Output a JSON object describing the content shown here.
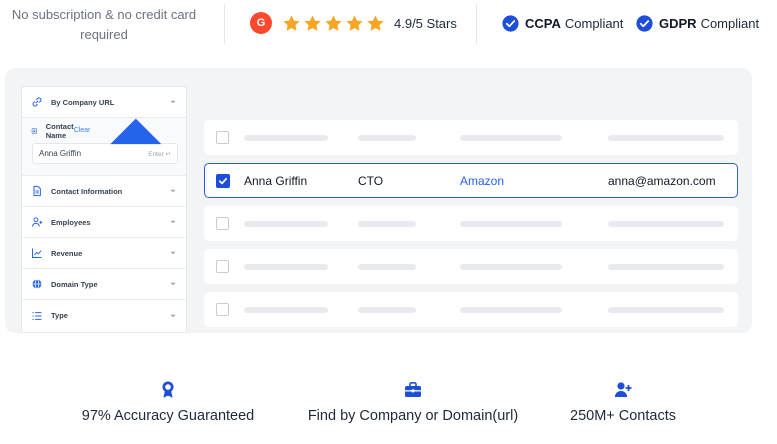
{
  "top_bar": {
    "no_cc_line1": "No subscription & no credit card",
    "no_cc_line2": "required",
    "g2_logo": "G",
    "rating_text": "4.9/5 Stars",
    "star_count": 5,
    "star_color": "#f5a623",
    "badges": [
      {
        "bold": "CCPA",
        "label": "Compliant"
      },
      {
        "bold": "GDPR",
        "label": "Compliant"
      }
    ],
    "badge_color": "#1d4ed8"
  },
  "filters": {
    "by_company_url": "By Company URL",
    "contact_name": "Contact Name",
    "clear": "Clear",
    "contact_value": "Anna Griffin",
    "enter_hint": "Enter ↵",
    "items": [
      {
        "label": "Contact Information",
        "icon": "document-icon"
      },
      {
        "label": "Employees",
        "icon": "user-plus-icon"
      },
      {
        "label": "Revenue",
        "icon": "chart-line-icon"
      },
      {
        "label": "Domain Type",
        "icon": "globe-icon"
      },
      {
        "label": "Type",
        "icon": "list-icon"
      }
    ]
  },
  "results": {
    "selected": {
      "name": "Anna Griffin",
      "title": "CTO",
      "company": "Amazon",
      "email": "anna@amazon.com"
    }
  },
  "features": [
    {
      "icon": "award-icon",
      "text": "97% Accuracy Guaranteed"
    },
    {
      "icon": "briefcase-icon",
      "text": "Find by Company or Domain(url)"
    },
    {
      "icon": "user-add-icon",
      "text": "250M+ Contacts"
    }
  ],
  "colors": {
    "accent_blue": "#1d4ed8",
    "link_blue": "#2563eb",
    "g2_red": "#ff492c",
    "panel_bg": "#f3f4f6"
  }
}
